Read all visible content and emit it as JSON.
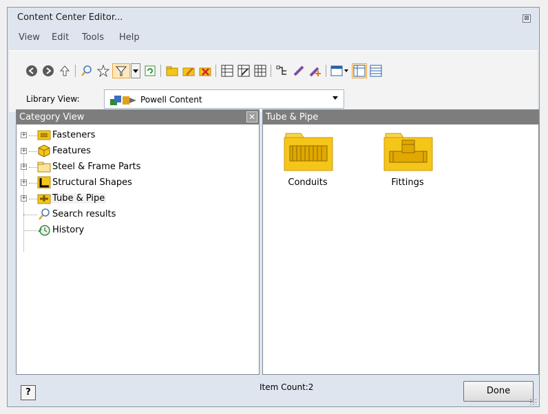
{
  "window": {
    "title": "Content Center Editor...",
    "close_glyph": "⊠"
  },
  "menu": [
    "View",
    "Edit",
    "Tools",
    "Help"
  ],
  "toolbar": {
    "icons": [
      "back-icon",
      "forward-icon",
      "up-icon",
      "search-icon",
      "favorite-icon",
      "filter-icon",
      "filter-dropdown-icon",
      "refresh-icon",
      "new-folder-icon",
      "edit-family-icon",
      "delete-icon",
      "table-view-icon",
      "edit-table-icon",
      "table-properties-icon",
      "assign-icon",
      "pipe-icon",
      "add-pipe-icon",
      "view-options-icon",
      "tree-view-icon",
      "detail-view-icon"
    ]
  },
  "library": {
    "label": "Library View:",
    "value": "Powell Content"
  },
  "category_pane": {
    "title": "Category View",
    "items": [
      {
        "label": "Fasteners",
        "icon": "fasteners-icon",
        "expandable": true
      },
      {
        "label": "Features",
        "icon": "features-icon",
        "expandable": true
      },
      {
        "label": "Steel & Frame Parts",
        "icon": "folder-icon",
        "expandable": true
      },
      {
        "label": "Structural Shapes",
        "icon": "structural-shapes-icon",
        "expandable": true
      },
      {
        "label": "Tube & Pipe",
        "icon": "tube-pipe-icon",
        "expandable": true,
        "selected": true
      },
      {
        "label": "Search results",
        "icon": "search-results-icon",
        "expandable": false
      },
      {
        "label": "History",
        "icon": "history-icon",
        "expandable": false
      }
    ]
  },
  "content_pane": {
    "title": "Tube & Pipe",
    "items": [
      {
        "label": "Conduits",
        "icon": "conduits-folder-icon"
      },
      {
        "label": "Fittings",
        "icon": "fittings-folder-icon"
      }
    ]
  },
  "status": {
    "item_count": "Item Count:2",
    "done_label": "Done",
    "help_glyph": "?"
  },
  "colors": {
    "folder": "#f5c518",
    "header": "#7d7d7d",
    "selection": "#f3a536"
  }
}
